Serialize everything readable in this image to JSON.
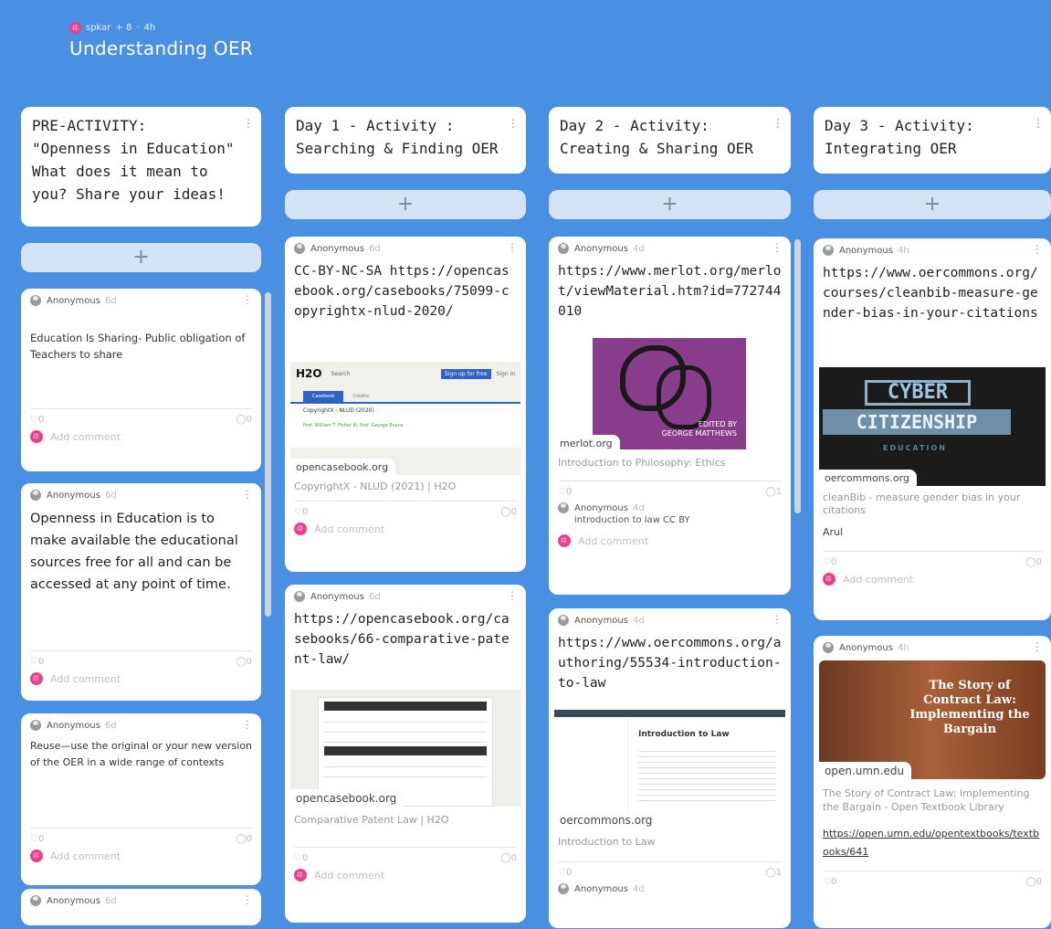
{
  "board": {
    "author": "spkar",
    "contributors": "+ 8",
    "age": "4h",
    "title": "Understanding OER"
  },
  "columns": [
    {
      "title_lines": [
        "PRE-ACTIVITY:",
        "\"Openness in Education\"",
        "What does it mean to",
        "you? Share your ideas!"
      ]
    },
    {
      "title_lines": [
        "Day 1 - Activity :",
        "Searching & Finding OER"
      ]
    },
    {
      "title_lines": [
        "Day 2 - Activity:",
        "Creating & Sharing OER"
      ]
    },
    {
      "title_lines": [
        "Day 3 - Activity:",
        "Integrating OER"
      ]
    }
  ],
  "add_label": "+",
  "author": "Anonymous",
  "add_comment": "Add comment",
  "cards": {
    "c1a": {
      "age": "6d",
      "text": "Education Is Sharing- Public obligation of Teachers to share",
      "likes": "0",
      "comments": "0"
    },
    "c1b": {
      "age": "6d",
      "text": "Openness in Education is to make available the educational sources free for all and can be accessed at any point of time.",
      "likes": "0",
      "comments": "0"
    },
    "c1c": {
      "age": "6d",
      "text": "Reuse—use the original or your new version of the OER in a wide range of contexts",
      "likes": "0",
      "comments": "0"
    },
    "c1d": {
      "age": "6d"
    },
    "c2a": {
      "age": "6d",
      "text": "CC-BY-NC-SA https://opencasebook.org/casebooks/75099-copyrightx-nlud-2020/",
      "domain": "opencasebook.org",
      "ptitle": "CopyrightX - NLUD (2021) | H2O",
      "likes": "0",
      "comments": "0",
      "preview": {
        "logo": "H2O",
        "search": "Search",
        "signup": "Sign up for free",
        "signin": "Sign in",
        "tab1": "Casebook",
        "tab2": "Credits",
        "heading": "CopyrightX - NLUD (2020)",
        "authors": "Prof. William T. Fisher III, Prof. George Evans"
      }
    },
    "c2b": {
      "age": "6d",
      "text": "https://opencasebook.org/casebooks/66-comparative-patent-law/",
      "domain": "opencasebook.org",
      "ptitle": "Comparative Patent Law | H2O",
      "likes": "0",
      "comments": "0"
    },
    "c3a": {
      "age": "4d",
      "text": "https://www.merlot.org/merlot/viewMaterial.htm?id=772744010",
      "domain": "merlot.org",
      "ptitle": "Introduction to Philosophy: Ethics",
      "likes": "0",
      "comments": "1",
      "cover": {
        "line1": "EDITED BY",
        "line2": "GEORGE MATTHEWS"
      },
      "reply": {
        "author": "Anonymous",
        "age": "4d",
        "text": "introduction to law CC BY"
      }
    },
    "c3b": {
      "age": "4d",
      "text": "https://www.oercommons.org/authoring/55534-introduction-to-law",
      "domain": "oercommons.org",
      "ptitle": "Introduction to Law",
      "likes": "0",
      "comments": "1",
      "preview": {
        "heading": "Introduction to Law"
      },
      "reply": {
        "author": "Anonymous",
        "age": "4d"
      }
    },
    "c4a": {
      "age": "4h",
      "text": "https://www.oercommons.org/courses/cleanbib-measure-gender-bias-in-your-citations",
      "domain": "oercommons.org",
      "ptitle": "cleanBib - measure gender bias in your citations",
      "extra": "Arul",
      "likes": "0",
      "comments": "0",
      "cover": {
        "line1": "CYBER",
        "line2": "CITIZENSHIP",
        "line3": "EDUCATION"
      }
    },
    "c4b": {
      "age": "4h",
      "domain": "open.umn.edu",
      "ptitle": "The Story of Contract Law: Implementing the Bargain - Open Textbook Library",
      "link": "https://open.umn.edu/opentextbooks/textbooks/641",
      "likes": "0",
      "comments": "0",
      "cover": {
        "title": "The Story of Contract Law: Implementing the Bargain"
      }
    }
  },
  "colors": {
    "background": "#4a90e2",
    "add_bar": "#d4e3f5",
    "avatar": "#e8408a"
  }
}
